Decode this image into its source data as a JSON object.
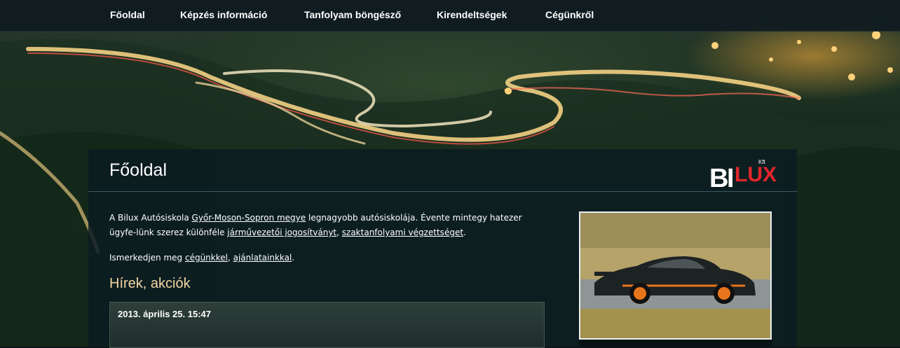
{
  "nav": {
    "items": [
      {
        "label": "Főoldal"
      },
      {
        "label": "Képzés információ"
      },
      {
        "label": "Tanfolyam böngésző"
      },
      {
        "label": "Kirendeltségek"
      },
      {
        "label": "Cégünkről"
      }
    ]
  },
  "page": {
    "title": "Főoldal"
  },
  "logo": {
    "text_b": "B",
    "text_i": "I",
    "text_lux": "LUX",
    "suffix": "Kft"
  },
  "intro": {
    "p1_part1": "A Bilux Autósiskola ",
    "p1_link1": "Győr-Moson-Sopron megye",
    "p1_part2": " legnagyobb autósiskolája. Évente mintegy hatezer ügyfe-lünk szerez különféle ",
    "p1_link2": "járművezetői jogosítványt",
    "p1_part3": ", ",
    "p1_link3": "szaktanfolyami végzettséget",
    "p1_part4": ".",
    "p2_part1": "Ismerkedjen meg ",
    "p2_link1": "cégünkkel",
    "p2_part2": ", ",
    "p2_link2": "ajánlatainkkal",
    "p2_part3": "."
  },
  "news": {
    "title": "Hírek, akciók",
    "items": [
      {
        "date": "2013. április 25. 15:47"
      }
    ]
  },
  "colors": {
    "accent_title": "#f1d6a2",
    "logo_red": "#e2262b",
    "car_orange": "#e8761c"
  }
}
